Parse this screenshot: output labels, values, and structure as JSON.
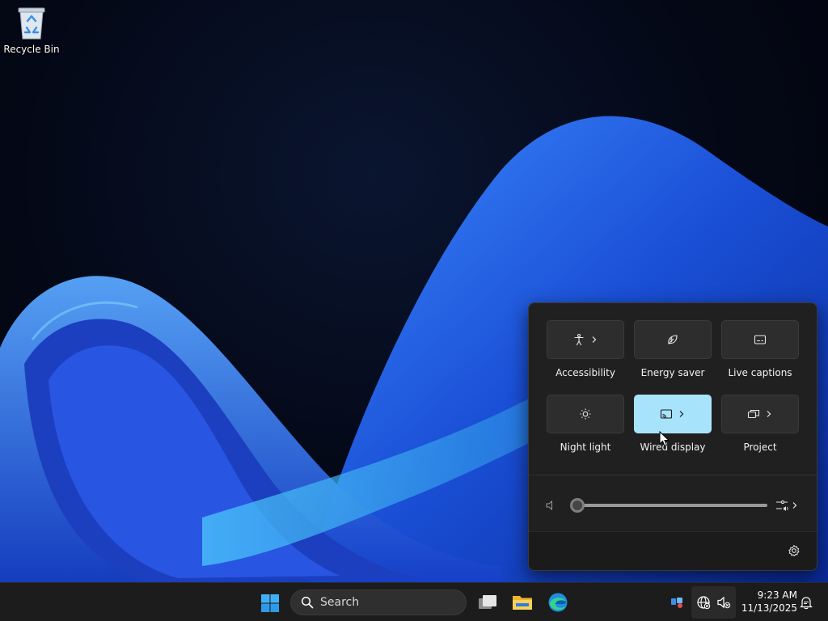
{
  "desktop": {
    "icons": [
      {
        "label": "Recycle Bin",
        "icon": "recycle-bin-icon"
      }
    ]
  },
  "quick_settings": {
    "tiles": [
      {
        "label": "Accessibility",
        "icon": "accessibility-icon",
        "has_chevron": true,
        "active": false
      },
      {
        "label": "Energy saver",
        "icon": "energy-saver-icon",
        "has_chevron": false,
        "active": false
      },
      {
        "label": "Live captions",
        "icon": "live-captions-icon",
        "has_chevron": false,
        "active": false
      },
      {
        "label": "Night light",
        "icon": "night-light-icon",
        "has_chevron": false,
        "active": false
      },
      {
        "label": "Wired display",
        "icon": "cast-icon",
        "has_chevron": true,
        "active": true
      },
      {
        "label": "Project",
        "icon": "project-icon",
        "has_chevron": true,
        "active": false
      }
    ],
    "volume": {
      "level_percent": 0,
      "icon": "speaker-muted-icon"
    },
    "footer": {
      "settings_icon": "gear-icon"
    }
  },
  "taskbar": {
    "search_placeholder": "Search",
    "pinned_apps": [
      "task-view-icon",
      "file-explorer-icon",
      "edge-icon"
    ],
    "tray": {
      "time": "9:23 AM",
      "date": "11/13/2025",
      "icons": [
        "widgets-icon",
        "network-icon",
        "volume-muted-icon",
        "notification-icon"
      ]
    }
  },
  "colors": {
    "accent": "#a7e4fb",
    "flyout_bg": "#202020",
    "taskbar_bg": "#1c1c1c"
  }
}
